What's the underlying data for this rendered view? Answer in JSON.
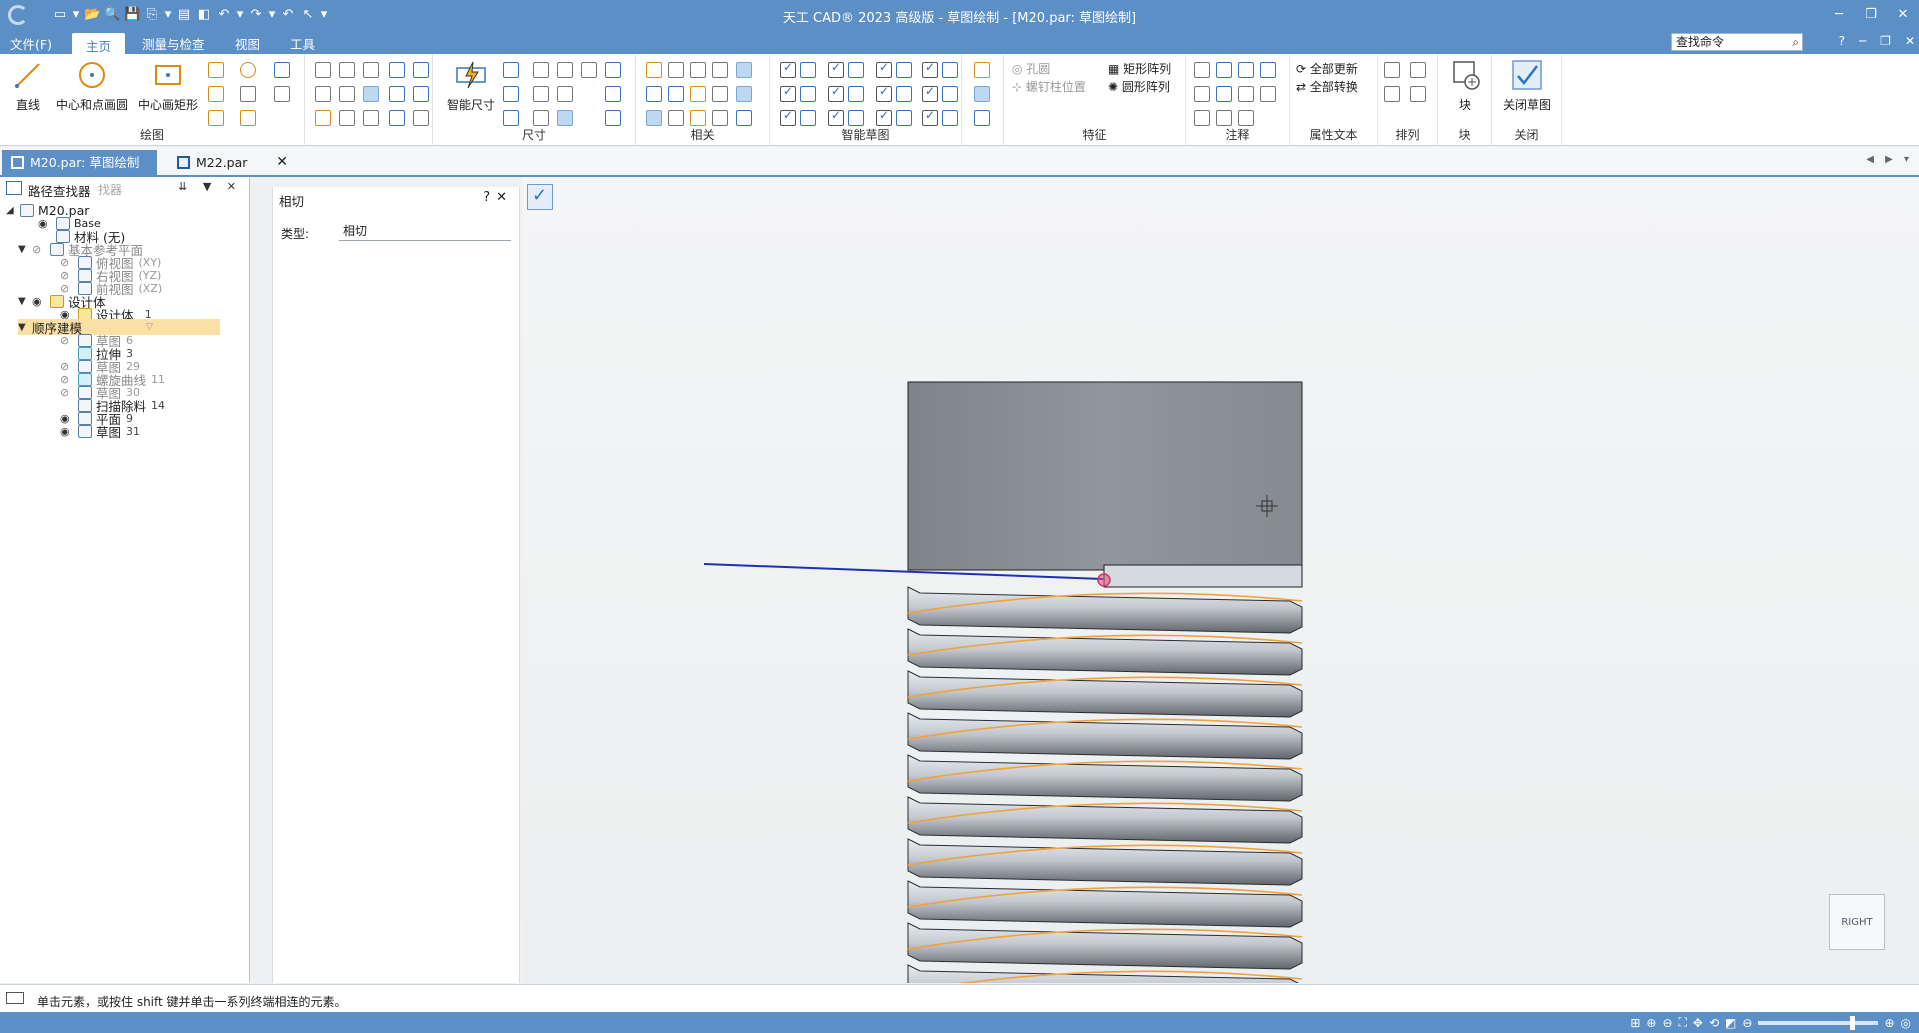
{
  "window": {
    "title": "天工 CAD® 2023 高级版 - 草图绘制 - [M20.par: 草图绘制]",
    "controls": [
      "─",
      "❐",
      "✕"
    ]
  },
  "quick_access": [
    "▭",
    "▾",
    "📂",
    "🔍",
    "💾",
    "⎘",
    "▾",
    "▤",
    "◧",
    "↶",
    "▾",
    "↷",
    "▾",
    "↶",
    "↖",
    "▾"
  ],
  "menu": {
    "items": [
      "文件(F)",
      "主页",
      "测量与检查",
      "视图",
      "工具"
    ],
    "active": "主页",
    "search_placeholder": "查找命令",
    "right_icons": [
      "?",
      "─",
      "❐",
      "✕"
    ]
  },
  "ribbon": {
    "groups": [
      {
        "label": "绘图",
        "big_buttons": [
          "直线",
          "中心和点画圆",
          "中心画矩形"
        ]
      },
      {
        "label": "尺寸",
        "big_buttons": [
          "智能尺寸"
        ]
      },
      {
        "label": "相关"
      },
      {
        "label": "智能草图"
      },
      {
        "label": "特征",
        "items": [
          "孔圆",
          "螺钉柱位置",
          "矩形阵列",
          "圆形阵列"
        ]
      },
      {
        "label": "注释"
      },
      {
        "label": "属性文本",
        "items": [
          "全部更新",
          "全部转换"
        ]
      },
      {
        "label": "排列"
      },
      {
        "label": "块",
        "big_buttons": [
          "块"
        ]
      },
      {
        "label": "关闭",
        "big_buttons": [
          "关闭草图"
        ]
      }
    ]
  },
  "doc_tabs": [
    {
      "label": "M20.par: 草图绘制",
      "active": true
    },
    {
      "label": "M22.par",
      "active": false
    }
  ],
  "pathfinder": {
    "title": "路径查找器",
    "ghost": "找器",
    "tree": [
      {
        "label": "M20.par",
        "count": "",
        "level": 0,
        "dim": false
      },
      {
        "label": "Base",
        "count": "",
        "level": 1,
        "dim": false
      },
      {
        "label": "材料 (无)",
        "count": "",
        "level": 1,
        "dim": false
      },
      {
        "label": "基本参考平面",
        "count": "",
        "level": 1,
        "dim": true
      },
      {
        "label": "俯视图",
        "count": "(XY)",
        "level": 2,
        "dim": true
      },
      {
        "label": "右视图",
        "count": "(YZ)",
        "level": 2,
        "dim": true
      },
      {
        "label": "前视图",
        "count": "(XZ)",
        "level": 2,
        "dim": true
      },
      {
        "label": "设计体",
        "count": "",
        "level": 1,
        "dim": false
      },
      {
        "label": "设计体_",
        "count": "1",
        "level": 2,
        "dim": false
      },
      {
        "label": "顺序建模",
        "count": "",
        "level": 1,
        "dim": false
      },
      {
        "label": "草图",
        "count": "6",
        "level": 2,
        "dim": true
      },
      {
        "label": "拉伸",
        "count": "3",
        "level": 2,
        "dim": false
      },
      {
        "label": "草图",
        "count": "29",
        "level": 2,
        "dim": true
      },
      {
        "label": "螺旋曲线",
        "count": "11",
        "level": 2,
        "dim": true
      },
      {
        "label": "草图",
        "count": "30",
        "level": 2,
        "dim": true
      },
      {
        "label": "扫描除料",
        "count": "14",
        "level": 2,
        "dim": false
      },
      {
        "label": "平面",
        "count": "9",
        "level": 2,
        "dim": false
      },
      {
        "label": "草图",
        "count": "31",
        "level": 2,
        "dim": false
      }
    ]
  },
  "property_panel": {
    "title": "相切",
    "help": "?",
    "close": "✕",
    "type_label": "类型:",
    "type_value": "相切"
  },
  "canvas": {
    "view_label": "RIGHT"
  },
  "status": {
    "prompt": "单击元素，或按住 shift 键并单击一系列终端相连的元素。"
  },
  "colors": {
    "title_bar": "#5b8fc6",
    "highlight": "#fbe0a6",
    "curve": "#f0a23c",
    "sketch_line": "#1e2fb8",
    "part": "#8b9096"
  }
}
